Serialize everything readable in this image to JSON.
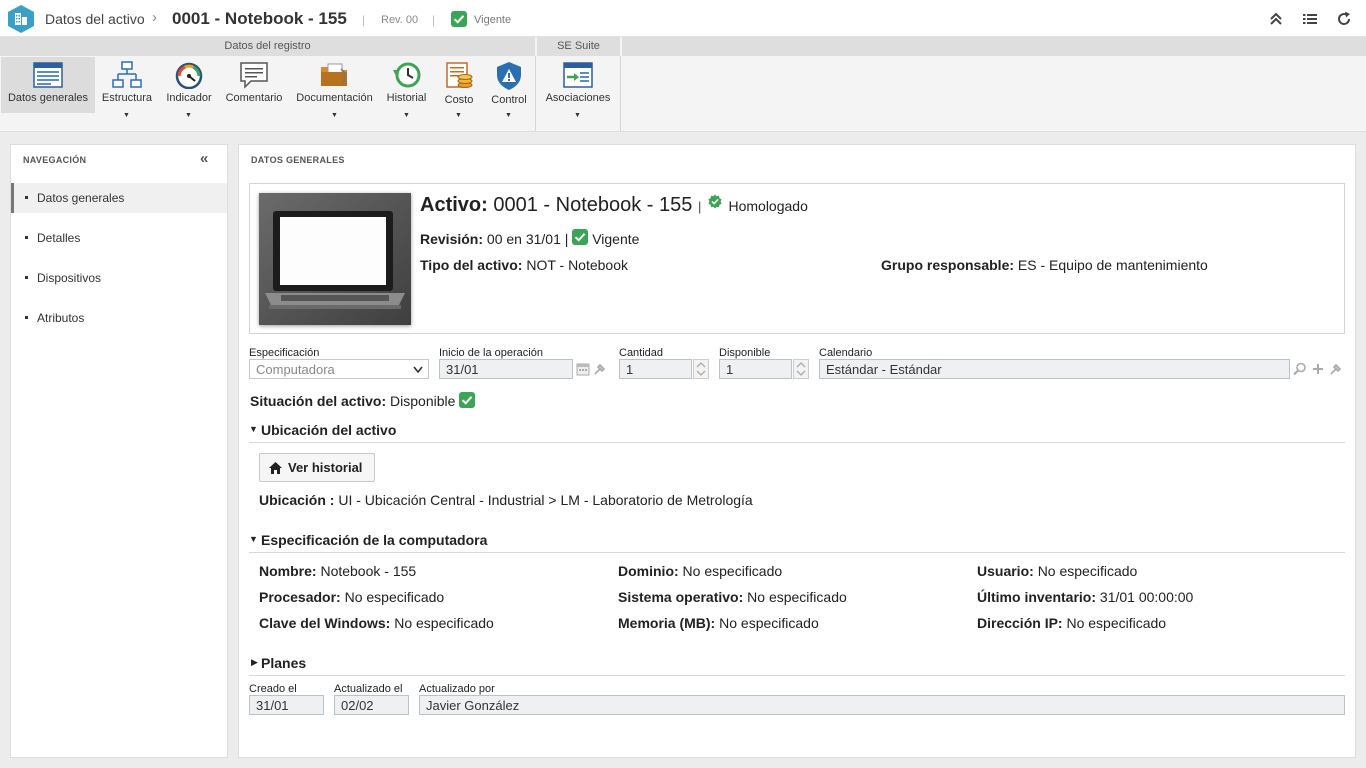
{
  "header": {
    "crumb": "Datos del activo",
    "crumb_sep": "›",
    "title": "0001 - Notebook - 155",
    "pipe": "|",
    "revision": "Rev. 00",
    "status": "Vigente",
    "icons": [
      "chevrons-up-icon",
      "list-icon",
      "refresh-icon"
    ]
  },
  "ribbon": {
    "group1": "Datos del registro",
    "group2": "SE Suite",
    "buttons": [
      {
        "label": "Datos generales",
        "icon": "window-icon"
      },
      {
        "label": "Estructura",
        "icon": "structure-icon"
      },
      {
        "label": "Indicador",
        "icon": "gauge-icon"
      },
      {
        "label": "Comentario",
        "icon": "comment-icon"
      },
      {
        "label": "Documentación",
        "icon": "folder-icon"
      },
      {
        "label": "Historial",
        "icon": "history-icon"
      },
      {
        "label": "Costo",
        "icon": "cost-icon"
      },
      {
        "label": "Control",
        "icon": "shield-warning-icon"
      },
      {
        "label": "Asociaciones",
        "icon": "associations-icon"
      }
    ],
    "caret": "▼"
  },
  "nav": {
    "title": "NAVEGACIÓN",
    "collapse": "«",
    "items": [
      "Datos generales",
      "Detalles",
      "Dispositivos",
      "Atributos"
    ]
  },
  "main": {
    "title": "DATOS GENERALES",
    "activo_label": "Activo:",
    "activo_value": "0001 - Notebook - 155",
    "pipe": "|",
    "homologado": "Homologado",
    "revision_label": "Revisión:",
    "revision_value": "00 en 31/01",
    "vigente": "Vigente",
    "tipo_label": "Tipo del activo:",
    "tipo_value": "NOT - Notebook",
    "grupo_label": "Grupo responsable:",
    "grupo_value": "ES - Equipo de mantenimiento"
  },
  "fields": {
    "especificacion_label": "Especificación",
    "especificacion_value": "Computadora",
    "inicio_label": "Inicio de la operación",
    "inicio_value": "31/01",
    "cantidad_label": "Cantidad",
    "cantidad_value": "1",
    "disponible_label": "Disponible",
    "disponible_value": "1",
    "calendario_label": "Calendario",
    "calendario_value": "Estándar - Estándar"
  },
  "situacion": {
    "label": "Situación del activo:",
    "value": "Disponible"
  },
  "ubicacion": {
    "section": "Ubicación del activo",
    "button": "Ver historial",
    "label": "Ubicación :",
    "value": "UI - Ubicación Central - Industrial > LM - Laboratorio de Metrología"
  },
  "spec": {
    "section": "Especificación de la computadora",
    "rows": [
      {
        "label": "Nombre:",
        "value": "Notebook - 155"
      },
      {
        "label": "Dominio:",
        "value": "No especificado"
      },
      {
        "label": "Usuario:",
        "value": "No especificado"
      },
      {
        "label": "Procesador:",
        "value": "No especificado"
      },
      {
        "label": "Sistema operativo:",
        "value": "No especificado"
      },
      {
        "label": "Último inventario:",
        "value": "31/01 00:00:00"
      },
      {
        "label": "Clave del Windows:",
        "value": "No especificado"
      },
      {
        "label": "Memoria (MB):",
        "value": "No especificado"
      },
      {
        "label": "Dirección IP:",
        "value": "No especificado"
      }
    ]
  },
  "planes": {
    "section": "Planes"
  },
  "footer": {
    "creado_label": "Creado el",
    "creado_value": "31/01",
    "actualizado_label": "Actualizado el",
    "actualizado_value": "02/02",
    "por_label": "Actualizado por",
    "por_value": "Javier González"
  },
  "colors": {
    "accent": "#3aa0c8",
    "green": "#3aa655",
    "ribbon_bg": "#f4f4f4"
  }
}
